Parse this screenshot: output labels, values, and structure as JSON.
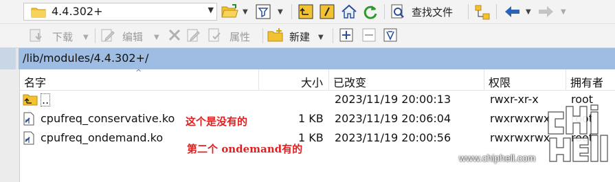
{
  "toolbar": {
    "location_value": "4.4.302+",
    "find_files_label": "查找文件",
    "download_label": "下载",
    "edit_label": "编辑",
    "properties_label": "属性",
    "new_label": "新建"
  },
  "path_bar": {
    "path": "/lib/modules/4.4.302+/"
  },
  "table": {
    "columns": [
      "名字",
      "大小",
      "已改变",
      "权限",
      "拥有者"
    ],
    "rows": [
      {
        "name": "..",
        "size": "",
        "modified": "2023/11/19 20:00:13",
        "permissions": "rwxr-xr-x",
        "owner": "root"
      },
      {
        "name": "cpufreq_conservative.ko",
        "size": "1 KB",
        "modified": "2023/11/19 20:06:04",
        "permissions": "rwxrwxrwx",
        "owner": "root"
      },
      {
        "name": "cpufreq_ondemand.ko",
        "size": "1 KB",
        "modified": "2023/11/19 20:00:56",
        "permissions": "rwxrwxrwx",
        "owner": "root"
      }
    ]
  },
  "annotations": {
    "note1": "这个是没有的",
    "note2": "第二个 ondemand有的"
  },
  "watermark": {
    "logo_text": "chip hell",
    "url": "www.chiphell.com"
  },
  "colors": {
    "path_bar": "#9fbde3",
    "annotation": "#e02020",
    "folder": "#f2c232"
  }
}
